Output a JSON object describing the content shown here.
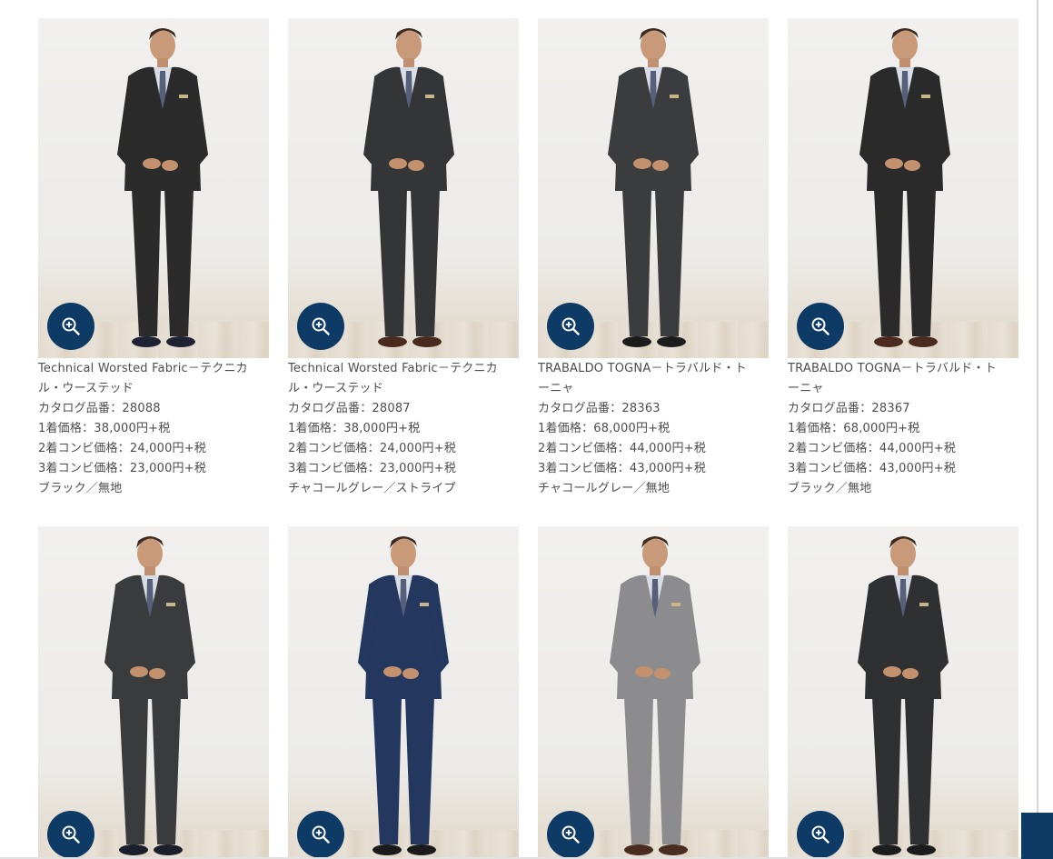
{
  "products": [
    {
      "title": "Technical Worsted Fabric－テクニカル・ウーステッド",
      "catalog": "カタログ品番：28088",
      "price1": "1着価格：38,000円+税",
      "price2": "2着コンビ価格：24,000円+税",
      "price3": "3着コンビ価格：23,000円+税",
      "color": "ブラック／無地",
      "suit_color": "#2b2b2c",
      "shoe_color": "#1f2233"
    },
    {
      "title": "Technical Worsted Fabric－テクニカル・ウーステッド",
      "catalog": "カタログ品番：28087",
      "price1": "1着価格：38,000円+税",
      "price2": "2着コンビ価格：24,000円+税",
      "price3": "3着コンビ価格：23,000円+税",
      "color": "チャコールグレー／ストライプ",
      "suit_color": "#343536",
      "shoe_color": "#4a2a1e"
    },
    {
      "title": "TRABALDO TOGNA－トラバルド・トーニャ",
      "catalog": "カタログ品番：28363",
      "price1": "1着価格：68,000円+税",
      "price2": "2着コンビ価格：44,000円+税",
      "price3": "3着コンビ価格：43,000円+税",
      "color": "チャコールグレー／無地",
      "suit_color": "#3b3c3e",
      "shoe_color": "#1c1c1c"
    },
    {
      "title": "TRABALDO TOGNA－トラバルド・トーニャ",
      "catalog": "カタログ品番：28367",
      "price1": "1着価格：68,000円+税",
      "price2": "2着コンビ価格：44,000円+税",
      "price3": "3着コンビ価格：43,000円+税",
      "color": "ブラック／無地",
      "suit_color": "#2a2a2b",
      "shoe_color": "#4b2b1f"
    },
    {
      "title": "",
      "catalog": "",
      "price1": "",
      "price2": "",
      "price3": "",
      "color": "",
      "suit_color": "#3a3b3d",
      "shoe_color": "#1b1f2c"
    },
    {
      "title": "",
      "catalog": "",
      "price1": "",
      "price2": "",
      "price3": "",
      "color": "",
      "suit_color": "#23375f",
      "shoe_color": "#1a1a1a"
    },
    {
      "title": "",
      "catalog": "",
      "price1": "",
      "price2": "",
      "price3": "",
      "color": "",
      "suit_color": "#8c8c8e",
      "shoe_color": "#4a2c20"
    },
    {
      "title": "",
      "catalog": "",
      "price1": "",
      "price2": "",
      "price3": "",
      "color": "",
      "suit_color": "#2f3032",
      "shoe_color": "#1c1c1c"
    }
  ],
  "icons": {
    "zoom": "zoom-in-icon"
  },
  "colors": {
    "accent": "#0e3a66",
    "text": "#4d4d4d"
  }
}
